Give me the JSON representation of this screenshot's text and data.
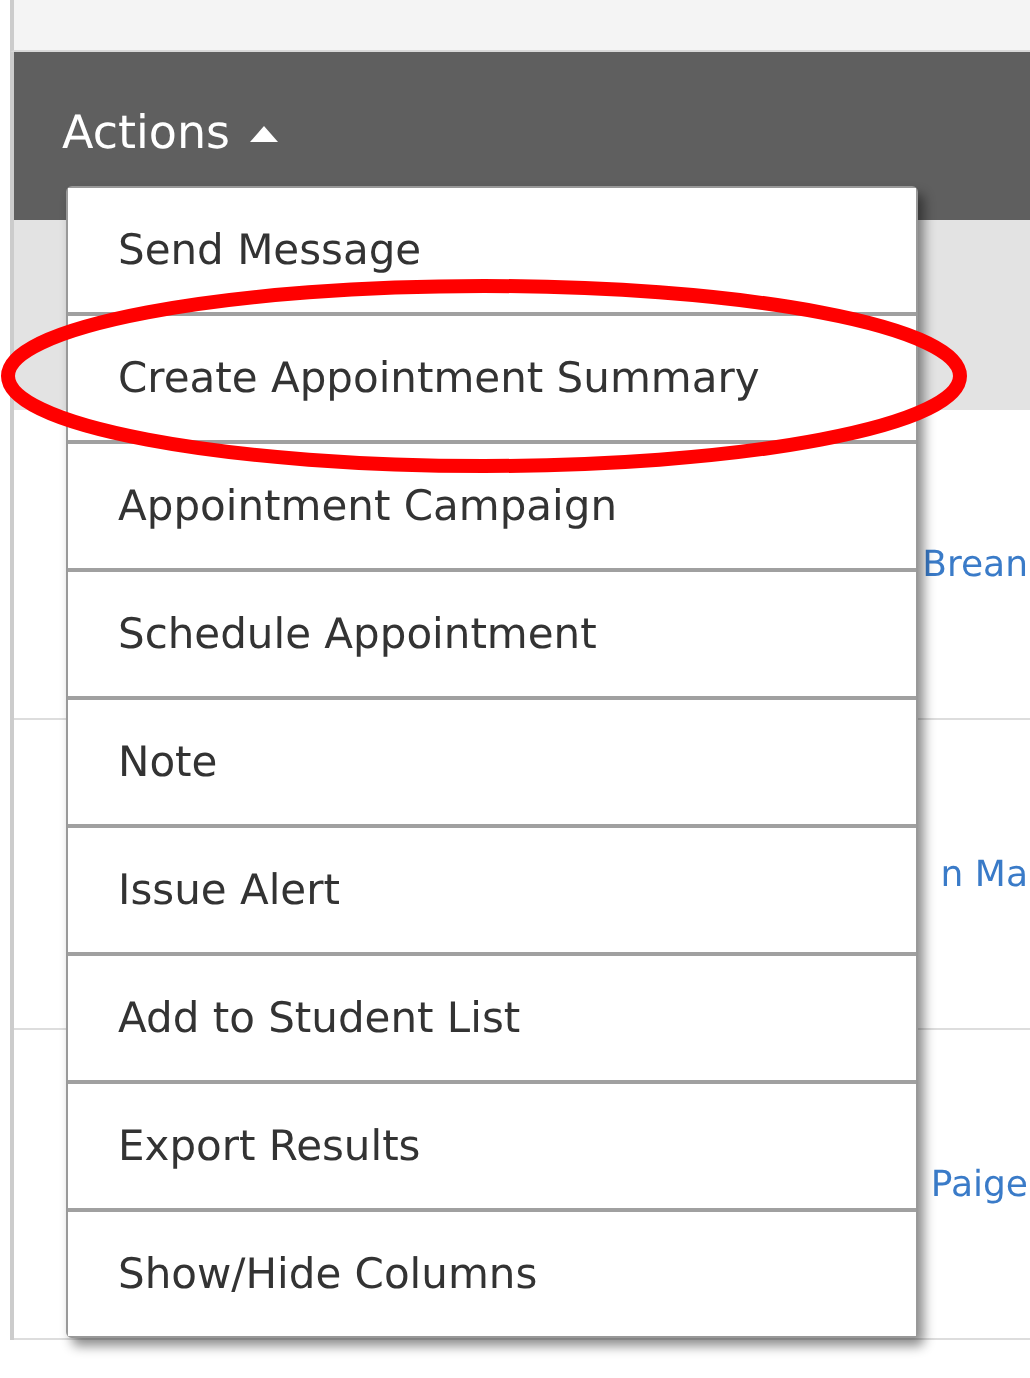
{
  "header": {
    "actions_button": {
      "label": "Actions",
      "expanded": true
    }
  },
  "actions_menu": [
    {
      "label": "Send Message",
      "circled": false
    },
    {
      "label": "Create Appointment Summary",
      "circled": true
    },
    {
      "label": "Appointment Campaign",
      "circled": false
    },
    {
      "label": "Schedule Appointment",
      "circled": false
    },
    {
      "label": "Note",
      "circled": false
    },
    {
      "label": "Issue Alert",
      "circled": false
    },
    {
      "label": "Add to Student List",
      "circled": false
    },
    {
      "label": "Export Results",
      "circled": false
    },
    {
      "label": "Show/Hide Columns",
      "circled": false
    }
  ],
  "table": {
    "rows": [
      {
        "link": "Brean"
      },
      {
        "link": "n Ma"
      },
      {
        "link": "Paige"
      }
    ]
  }
}
